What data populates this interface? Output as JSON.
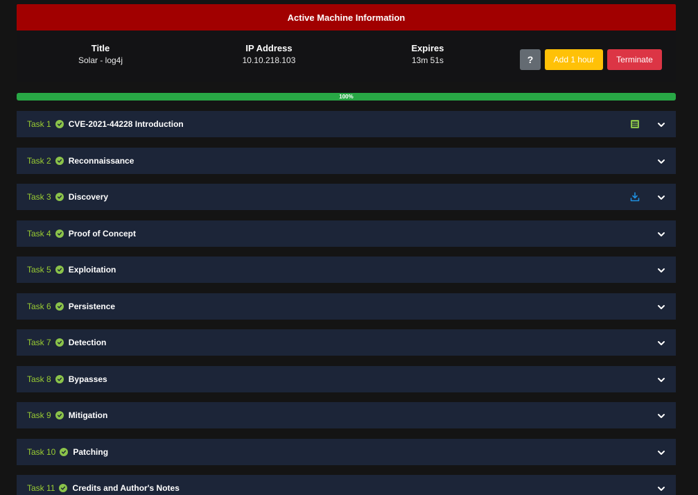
{
  "machine": {
    "header": "Active Machine Information",
    "title_label": "Title",
    "title_value": "Solar - log4j",
    "ip_label": "IP Address",
    "ip_value": "10.10.218.103",
    "expires_label": "Expires",
    "expires_value": "13m 51s",
    "help_label": "?",
    "add_hour_label": "Add 1 hour",
    "terminate_label": "Terminate"
  },
  "progress": {
    "percent": 100,
    "label": "100%"
  },
  "tasks": [
    {
      "num": "Task 1",
      "title": "CVE-2021-44228 Introduction",
      "extra_icon": "list-icon"
    },
    {
      "num": "Task 2",
      "title": "Reconnaissance"
    },
    {
      "num": "Task 3",
      "title": "Discovery",
      "extra_icon": "download-icon"
    },
    {
      "num": "Task 4",
      "title": "Proof of Concept"
    },
    {
      "num": "Task 5",
      "title": "Exploitation"
    },
    {
      "num": "Task 6",
      "title": "Persistence"
    },
    {
      "num": "Task 7",
      "title": "Detection"
    },
    {
      "num": "Task 8",
      "title": "Bypasses"
    },
    {
      "num": "Task 9",
      "title": "Mitigation"
    },
    {
      "num": "Task 10",
      "title": "Patching"
    },
    {
      "num": "Task 11",
      "title": "Credits and Author's Notes"
    }
  ],
  "colors": {
    "header_red": "#a10000",
    "task_bg": "#1c2538",
    "task_num_green": "#9acd32",
    "progress_green": "#28a745",
    "add_hour_yellow": "#ffc107",
    "terminate_red": "#dc3545"
  }
}
